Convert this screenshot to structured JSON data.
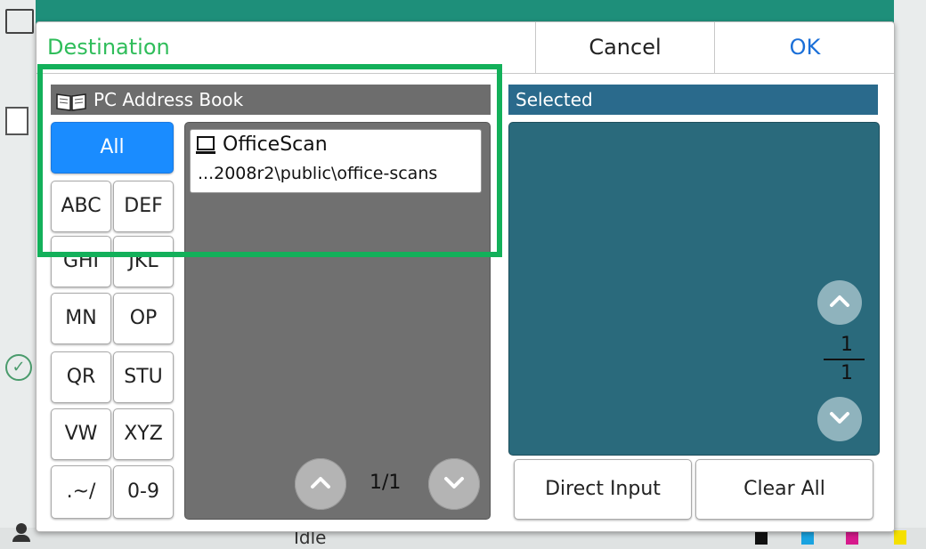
{
  "dialog": {
    "title": "Destination",
    "cancel_label": "Cancel",
    "ok_label": "OK"
  },
  "address_book": {
    "header": "PC Address Book",
    "filters": [
      {
        "label": "All",
        "selected": true
      },
      {
        "label": "ABC"
      },
      {
        "label": "DEF"
      },
      {
        "label": "GHI"
      },
      {
        "label": "JKL"
      },
      {
        "label": "MN"
      },
      {
        "label": "OP"
      },
      {
        "label": "QR"
      },
      {
        "label": "STU"
      },
      {
        "label": "VW"
      },
      {
        "label": "XYZ"
      },
      {
        "label": ".~/"
      },
      {
        "label": "0-9"
      }
    ],
    "entries": [
      {
        "name": "OfficeScan",
        "path": "...2008r2\\public\\office-scans",
        "icon": "computer-icon"
      }
    ],
    "page_indicator": "1/1"
  },
  "selected": {
    "header": "Selected",
    "page_current": "1",
    "page_total": "1",
    "direct_input_label": "Direct Input",
    "clear_all_label": "Clear All"
  },
  "status": {
    "state_text": "Idle",
    "toner": [
      {
        "label": "K",
        "color": "#111111"
      },
      {
        "label": "C",
        "color": "#1aa3e0"
      },
      {
        "label": "M",
        "color": "#d61a8c"
      },
      {
        "label": "Y",
        "color": "#f5e000"
      }
    ]
  },
  "colors": {
    "accent_green": "#2fbd5a",
    "ok_blue": "#1a6fd8",
    "all_button": "#1a8cff",
    "selected_panel": "#2a6a7c",
    "highlight": "#13b05a"
  }
}
